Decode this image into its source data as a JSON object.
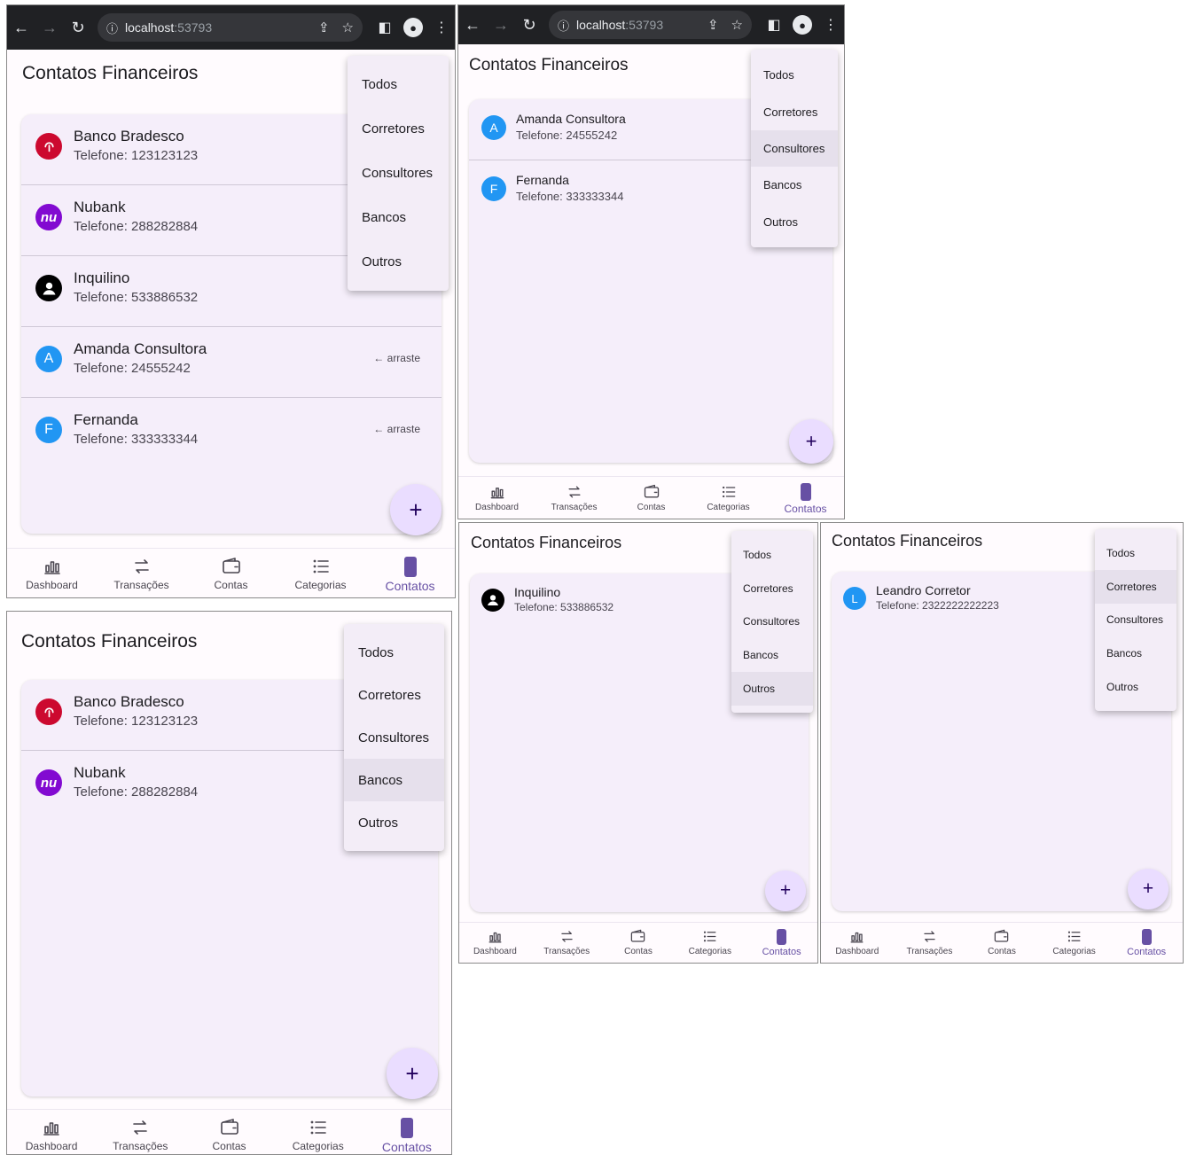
{
  "title": "Contatos Financeiros",
  "browser": {
    "host": "localhost",
    "port": ":53793"
  },
  "swipe_hint": "arraste",
  "menu": [
    "Todos",
    "Corretores",
    "Consultores",
    "Bancos",
    "Outros"
  ],
  "nav": [
    {
      "label": "Dashboard",
      "icon": "chart-icon"
    },
    {
      "label": "Transações",
      "icon": "swap-icon"
    },
    {
      "label": "Contas",
      "icon": "wallet-icon"
    },
    {
      "label": "Categorias",
      "icon": "list-icon"
    },
    {
      "label": "Contatos",
      "icon": "phone-icon"
    }
  ],
  "fab_symbol": "+",
  "contacts": {
    "bradesco": {
      "name": "Banco Bradesco",
      "phone": "Telefone: 123123123"
    },
    "nubank": {
      "name": "Nubank",
      "phone": "Telefone: 288282884",
      "logo": "nu"
    },
    "inquilino": {
      "name": "Inquilino",
      "phone": "Telefone: 533886532"
    },
    "amanda": {
      "name": "Amanda Consultora",
      "phone": "Telefone: 24555242",
      "initial": "A"
    },
    "fernanda": {
      "name": "Fernanda",
      "phone": "Telefone: 333333344",
      "initial": "F"
    },
    "leandro": {
      "name": "Leandro Corretor",
      "phone": "Telefone: 2322222222223",
      "initial": "L"
    }
  },
  "screens": [
    {
      "id": "todos",
      "filter_selected": "Todos",
      "contacts": [
        "bradesco",
        "nubank",
        "inquilino",
        "amanda",
        "fernanda"
      ]
    },
    {
      "id": "consultores",
      "filter_selected": "Consultores",
      "contacts": [
        "amanda",
        "fernanda"
      ]
    },
    {
      "id": "bancos",
      "filter_selected": "Bancos",
      "contacts": [
        "bradesco",
        "nubank"
      ]
    },
    {
      "id": "outros",
      "filter_selected": "Outros",
      "contacts": [
        "inquilino"
      ]
    },
    {
      "id": "corretores",
      "filter_selected": "Corretores",
      "contacts": [
        "leandro"
      ]
    }
  ],
  "colors": {
    "accent": "#6750a4",
    "fab": "#eaddff",
    "card": "#f5eefa",
    "bradesco": "#cc092f",
    "nubank": "#820ad1",
    "letter_avatar": "#2196f3"
  }
}
